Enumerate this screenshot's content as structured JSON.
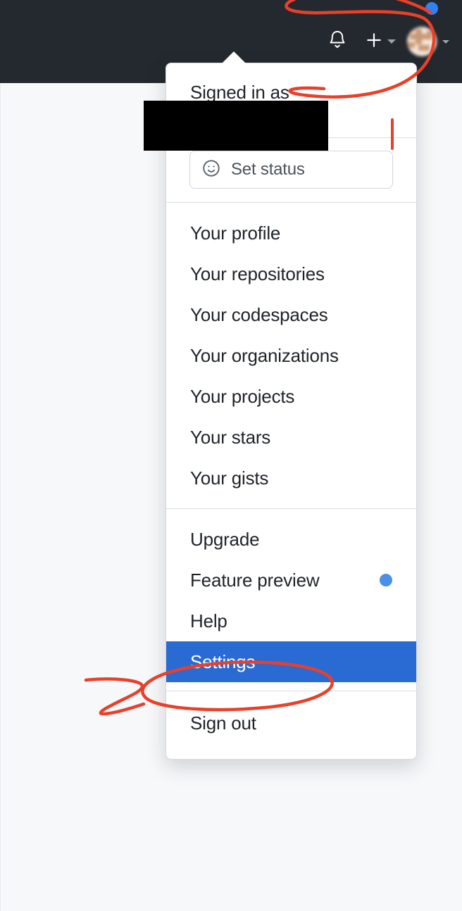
{
  "header": {
    "background_color": "#24292f",
    "icons": [
      {
        "name": "notifications-bell-icon",
        "label": "Notifications"
      },
      {
        "name": "create-new-plus-icon",
        "label": "Create new"
      },
      {
        "name": "user-avatar",
        "label": "Open user menu"
      }
    ],
    "notification_dot_color": "#2f81f7"
  },
  "menu": {
    "signed_in_label": "Signed in as",
    "username": "",
    "username_redacted": true,
    "status_button": {
      "label": "Set status",
      "icon": "smiley-face-icon"
    },
    "groups": [
      {
        "id": "account-group",
        "items": [
          {
            "label": "Your profile",
            "selected": false,
            "dot": false
          },
          {
            "label": "Your repositories",
            "selected": false,
            "dot": false
          },
          {
            "label": "Your codespaces",
            "selected": false,
            "dot": false
          },
          {
            "label": "Your organizations",
            "selected": false,
            "dot": false
          },
          {
            "label": "Your projects",
            "selected": false,
            "dot": false
          },
          {
            "label": "Your stars",
            "selected": false,
            "dot": false
          },
          {
            "label": "Your gists",
            "selected": false,
            "dot": false
          }
        ]
      },
      {
        "id": "settings-group",
        "items": [
          {
            "label": "Upgrade",
            "selected": false,
            "dot": false
          },
          {
            "label": "Feature preview",
            "selected": false,
            "dot": true
          },
          {
            "label": "Help",
            "selected": false,
            "dot": false
          },
          {
            "label": "Settings",
            "selected": true,
            "dot": false
          }
        ]
      },
      {
        "id": "session-group",
        "items": [
          {
            "label": "Sign out",
            "selected": false,
            "dot": false
          }
        ]
      }
    ],
    "selected_item_color": "#2a6ad3",
    "feature_preview_dot_color": "#4a90e8"
  },
  "annotations": {
    "color": "#e8402a",
    "marks": [
      {
        "name": "avatar-circle-annotation",
        "shape": "ellipse"
      },
      {
        "name": "settings-circle-annotation",
        "shape": "ellipse"
      },
      {
        "name": "settings-arrow-annotation",
        "shape": "arrow"
      },
      {
        "name": "tick-mark-annotation",
        "shape": "line"
      }
    ]
  },
  "page": {
    "background_color": "#f6f8fa"
  }
}
